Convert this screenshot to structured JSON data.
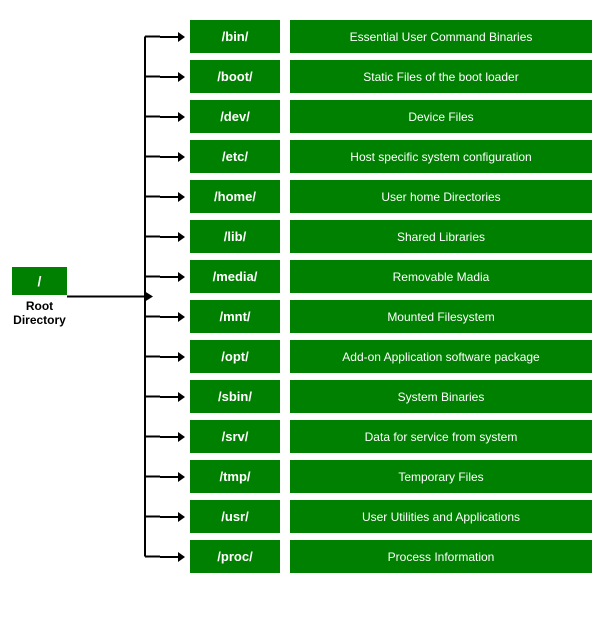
{
  "root": {
    "label": "/",
    "text_line1": "Root",
    "text_line2": "Directory"
  },
  "rows": [
    {
      "dir": "/bin/",
      "desc": "Essential User Command Binaries"
    },
    {
      "dir": "/boot/",
      "desc": "Static Files of the boot loader"
    },
    {
      "dir": "/dev/",
      "desc": "Device Files"
    },
    {
      "dir": "/etc/",
      "desc": "Host specific system configuration"
    },
    {
      "dir": "/home/",
      "desc": "User home Directories"
    },
    {
      "dir": "/lib/",
      "desc": "Shared Libraries"
    },
    {
      "dir": "/media/",
      "desc": "Removable Madia"
    },
    {
      "dir": "/mnt/",
      "desc": "Mounted Filesystem"
    },
    {
      "dir": "/opt/",
      "desc": "Add-on Application software package"
    },
    {
      "dir": "/sbin/",
      "desc": "System Binaries"
    },
    {
      "dir": "/srv/",
      "desc": "Data for service from system"
    },
    {
      "dir": "/tmp/",
      "desc": "Temporary Files"
    },
    {
      "dir": "/usr/",
      "desc": "User Utilities and Applications"
    },
    {
      "dir": "/proc/",
      "desc": "Process Information"
    }
  ],
  "colors": {
    "green": "#008000",
    "black": "#000000",
    "white": "#ffffff"
  }
}
